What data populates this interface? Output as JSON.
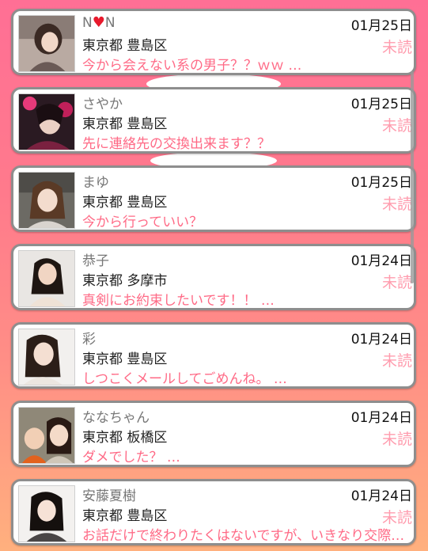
{
  "messages": [
    {
      "name": "N",
      "name_heart": "♥",
      "name_tail": "N",
      "location": "東京都 豊島区",
      "message": "今から会えない系の男子？？ｗｗ …",
      "date": "01月25日",
      "status": "未読",
      "avatar_icon": "profile-photo"
    },
    {
      "name": "さやか",
      "location": "東京都 豊島区",
      "message": "先に連絡先の交換出来ます？？",
      "date": "01月25日",
      "status": "未読",
      "avatar_icon": "profile-photo"
    },
    {
      "name": "まゆ",
      "location": "東京都 豊島区",
      "message": "今から行っていい？",
      "date": "01月25日",
      "status": "未読",
      "avatar_icon": "profile-photo"
    },
    {
      "name": "恭子",
      "location": "東京都 多摩市",
      "message": "真剣にお約束したいです！！ …",
      "date": "01月24日",
      "status": "未読",
      "avatar_icon": "profile-photo"
    },
    {
      "name": "彩",
      "location": "東京都 豊島区",
      "message": "しつこくメールしてごめんね。 …",
      "date": "01月24日",
      "status": "未読",
      "avatar_icon": "profile-photo"
    },
    {
      "name": "ななちゃん",
      "location": "東京都 板橋区",
      "message": "ダメでした？ …",
      "date": "01月24日",
      "status": "未読",
      "avatar_icon": "profile-photo"
    },
    {
      "name": "安藤夏樹",
      "location": "東京都 豊島区",
      "message": "お話だけで終わりたくはないですが、いきなり交際…",
      "date": "01月24日",
      "status": "未読",
      "avatar_icon": "profile-photo"
    }
  ],
  "colors": {
    "accent": "#ff6a86",
    "unread": "#ff9cae",
    "heart": "#e8192c",
    "card_border": "#8e8e8e"
  }
}
